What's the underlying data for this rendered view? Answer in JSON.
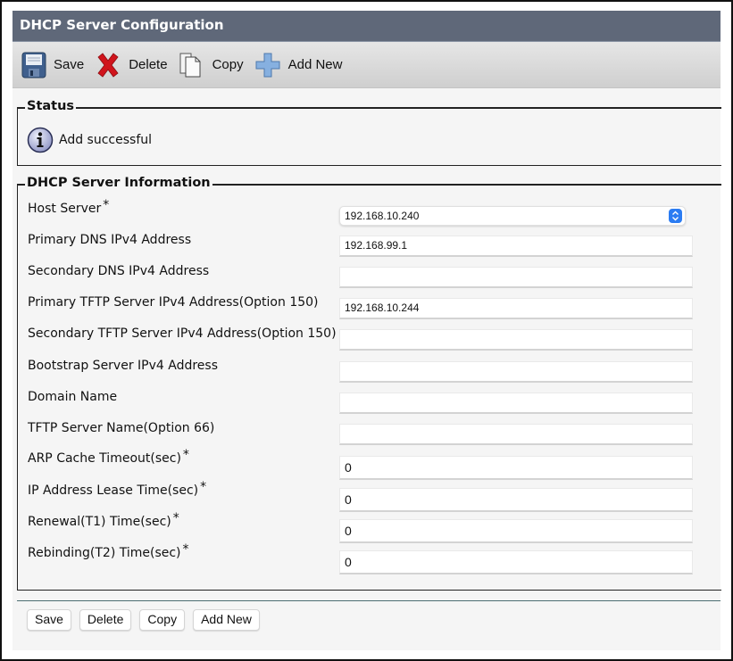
{
  "header": {
    "title": "DHCP Server Configuration"
  },
  "toolbar": {
    "save_label": "Save",
    "delete_label": "Delete",
    "copy_label": "Copy",
    "add_new_label": "Add New",
    "icons": [
      "floppy-disk-icon",
      "red-x-icon",
      "copy-pages-icon",
      "blue-plus-icon"
    ]
  },
  "status": {
    "legend": "Status",
    "icon": "info-icon",
    "message": "Add successful"
  },
  "info": {
    "legend": "DHCP Server Information",
    "required_marker": "*",
    "fields": [
      {
        "label": "Host Server",
        "required": true,
        "type": "select",
        "value": "192.168.10.240"
      },
      {
        "label": "Primary DNS IPv4 Address",
        "required": false,
        "type": "text",
        "value": "192.168.99.1"
      },
      {
        "label": "Secondary DNS IPv4 Address",
        "required": false,
        "type": "text",
        "value": ""
      },
      {
        "label": "Primary TFTP Server IPv4 Address(Option 150)",
        "required": false,
        "type": "text",
        "value": "192.168.10.244"
      },
      {
        "label": "Secondary TFTP Server IPv4 Address(Option 150)",
        "required": false,
        "type": "text",
        "value": ""
      },
      {
        "label": "Bootstrap Server IPv4 Address",
        "required": false,
        "type": "text",
        "value": ""
      },
      {
        "label": "Domain Name",
        "required": false,
        "type": "text",
        "value": ""
      },
      {
        "label": "TFTP Server Name(Option 66)",
        "required": false,
        "type": "text",
        "value": ""
      },
      {
        "label": "ARP Cache Timeout(sec)",
        "required": true,
        "type": "number",
        "value": "0"
      },
      {
        "label": "IP Address Lease Time(sec)",
        "required": true,
        "type": "number",
        "value": "0"
      },
      {
        "label": "Renewal(T1) Time(sec)",
        "required": true,
        "type": "number",
        "value": "0"
      },
      {
        "label": "Rebinding(T2) Time(sec)",
        "required": true,
        "type": "number",
        "value": "0"
      }
    ]
  },
  "bottom_buttons": {
    "save_label": "Save",
    "delete_label": "Delete",
    "copy_label": "Copy",
    "add_new_label": "Add New"
  },
  "colors": {
    "titlebar": "#5f6879",
    "select_arrow": "#2b7cf2",
    "delete_red": "#c8161d",
    "add_blue": "#7ea8d8"
  }
}
